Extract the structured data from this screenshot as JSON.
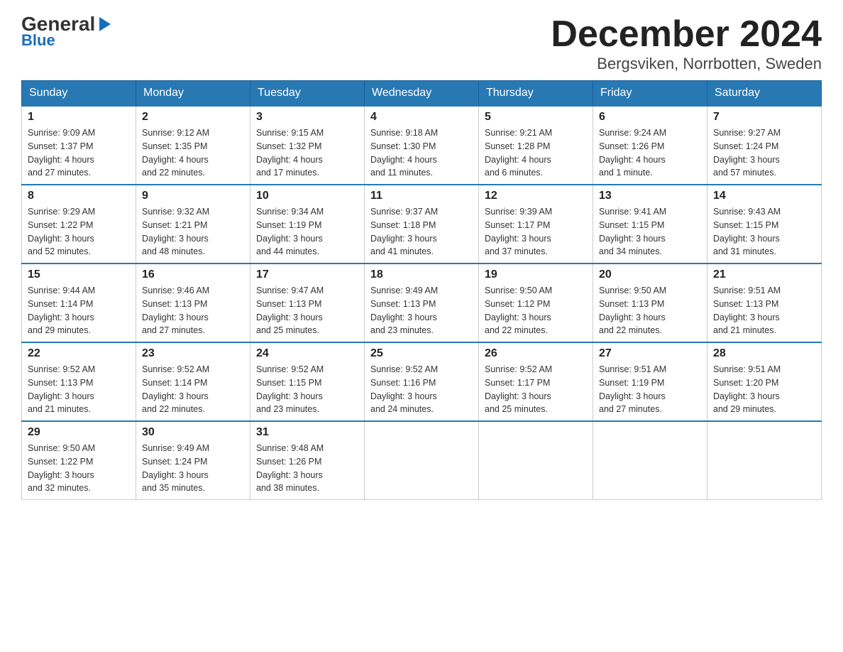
{
  "logo": {
    "text_general": "General",
    "text_blue": "Blue",
    "arrow_unicode": "▶"
  },
  "header": {
    "month_title": "December 2024",
    "location": "Bergsviken, Norrbotten, Sweden"
  },
  "weekdays": [
    "Sunday",
    "Monday",
    "Tuesday",
    "Wednesday",
    "Thursday",
    "Friday",
    "Saturday"
  ],
  "weeks": [
    [
      {
        "day": "1",
        "sunrise": "Sunrise: 9:09 AM",
        "sunset": "Sunset: 1:37 PM",
        "daylight": "Daylight: 4 hours",
        "daylight2": "and 27 minutes."
      },
      {
        "day": "2",
        "sunrise": "Sunrise: 9:12 AM",
        "sunset": "Sunset: 1:35 PM",
        "daylight": "Daylight: 4 hours",
        "daylight2": "and 22 minutes."
      },
      {
        "day": "3",
        "sunrise": "Sunrise: 9:15 AM",
        "sunset": "Sunset: 1:32 PM",
        "daylight": "Daylight: 4 hours",
        "daylight2": "and 17 minutes."
      },
      {
        "day": "4",
        "sunrise": "Sunrise: 9:18 AM",
        "sunset": "Sunset: 1:30 PM",
        "daylight": "Daylight: 4 hours",
        "daylight2": "and 11 minutes."
      },
      {
        "day": "5",
        "sunrise": "Sunrise: 9:21 AM",
        "sunset": "Sunset: 1:28 PM",
        "daylight": "Daylight: 4 hours",
        "daylight2": "and 6 minutes."
      },
      {
        "day": "6",
        "sunrise": "Sunrise: 9:24 AM",
        "sunset": "Sunset: 1:26 PM",
        "daylight": "Daylight: 4 hours",
        "daylight2": "and 1 minute."
      },
      {
        "day": "7",
        "sunrise": "Sunrise: 9:27 AM",
        "sunset": "Sunset: 1:24 PM",
        "daylight": "Daylight: 3 hours",
        "daylight2": "and 57 minutes."
      }
    ],
    [
      {
        "day": "8",
        "sunrise": "Sunrise: 9:29 AM",
        "sunset": "Sunset: 1:22 PM",
        "daylight": "Daylight: 3 hours",
        "daylight2": "and 52 minutes."
      },
      {
        "day": "9",
        "sunrise": "Sunrise: 9:32 AM",
        "sunset": "Sunset: 1:21 PM",
        "daylight": "Daylight: 3 hours",
        "daylight2": "and 48 minutes."
      },
      {
        "day": "10",
        "sunrise": "Sunrise: 9:34 AM",
        "sunset": "Sunset: 1:19 PM",
        "daylight": "Daylight: 3 hours",
        "daylight2": "and 44 minutes."
      },
      {
        "day": "11",
        "sunrise": "Sunrise: 9:37 AM",
        "sunset": "Sunset: 1:18 PM",
        "daylight": "Daylight: 3 hours",
        "daylight2": "and 41 minutes."
      },
      {
        "day": "12",
        "sunrise": "Sunrise: 9:39 AM",
        "sunset": "Sunset: 1:17 PM",
        "daylight": "Daylight: 3 hours",
        "daylight2": "and 37 minutes."
      },
      {
        "day": "13",
        "sunrise": "Sunrise: 9:41 AM",
        "sunset": "Sunset: 1:15 PM",
        "daylight": "Daylight: 3 hours",
        "daylight2": "and 34 minutes."
      },
      {
        "day": "14",
        "sunrise": "Sunrise: 9:43 AM",
        "sunset": "Sunset: 1:15 PM",
        "daylight": "Daylight: 3 hours",
        "daylight2": "and 31 minutes."
      }
    ],
    [
      {
        "day": "15",
        "sunrise": "Sunrise: 9:44 AM",
        "sunset": "Sunset: 1:14 PM",
        "daylight": "Daylight: 3 hours",
        "daylight2": "and 29 minutes."
      },
      {
        "day": "16",
        "sunrise": "Sunrise: 9:46 AM",
        "sunset": "Sunset: 1:13 PM",
        "daylight": "Daylight: 3 hours",
        "daylight2": "and 27 minutes."
      },
      {
        "day": "17",
        "sunrise": "Sunrise: 9:47 AM",
        "sunset": "Sunset: 1:13 PM",
        "daylight": "Daylight: 3 hours",
        "daylight2": "and 25 minutes."
      },
      {
        "day": "18",
        "sunrise": "Sunrise: 9:49 AM",
        "sunset": "Sunset: 1:13 PM",
        "daylight": "Daylight: 3 hours",
        "daylight2": "and 23 minutes."
      },
      {
        "day": "19",
        "sunrise": "Sunrise: 9:50 AM",
        "sunset": "Sunset: 1:12 PM",
        "daylight": "Daylight: 3 hours",
        "daylight2": "and 22 minutes."
      },
      {
        "day": "20",
        "sunrise": "Sunrise: 9:50 AM",
        "sunset": "Sunset: 1:13 PM",
        "daylight": "Daylight: 3 hours",
        "daylight2": "and 22 minutes."
      },
      {
        "day": "21",
        "sunrise": "Sunrise: 9:51 AM",
        "sunset": "Sunset: 1:13 PM",
        "daylight": "Daylight: 3 hours",
        "daylight2": "and 21 minutes."
      }
    ],
    [
      {
        "day": "22",
        "sunrise": "Sunrise: 9:52 AM",
        "sunset": "Sunset: 1:13 PM",
        "daylight": "Daylight: 3 hours",
        "daylight2": "and 21 minutes."
      },
      {
        "day": "23",
        "sunrise": "Sunrise: 9:52 AM",
        "sunset": "Sunset: 1:14 PM",
        "daylight": "Daylight: 3 hours",
        "daylight2": "and 22 minutes."
      },
      {
        "day": "24",
        "sunrise": "Sunrise: 9:52 AM",
        "sunset": "Sunset: 1:15 PM",
        "daylight": "Daylight: 3 hours",
        "daylight2": "and 23 minutes."
      },
      {
        "day": "25",
        "sunrise": "Sunrise: 9:52 AM",
        "sunset": "Sunset: 1:16 PM",
        "daylight": "Daylight: 3 hours",
        "daylight2": "and 24 minutes."
      },
      {
        "day": "26",
        "sunrise": "Sunrise: 9:52 AM",
        "sunset": "Sunset: 1:17 PM",
        "daylight": "Daylight: 3 hours",
        "daylight2": "and 25 minutes."
      },
      {
        "day": "27",
        "sunrise": "Sunrise: 9:51 AM",
        "sunset": "Sunset: 1:19 PM",
        "daylight": "Daylight: 3 hours",
        "daylight2": "and 27 minutes."
      },
      {
        "day": "28",
        "sunrise": "Sunrise: 9:51 AM",
        "sunset": "Sunset: 1:20 PM",
        "daylight": "Daylight: 3 hours",
        "daylight2": "and 29 minutes."
      }
    ],
    [
      {
        "day": "29",
        "sunrise": "Sunrise: 9:50 AM",
        "sunset": "Sunset: 1:22 PM",
        "daylight": "Daylight: 3 hours",
        "daylight2": "and 32 minutes."
      },
      {
        "day": "30",
        "sunrise": "Sunrise: 9:49 AM",
        "sunset": "Sunset: 1:24 PM",
        "daylight": "Daylight: 3 hours",
        "daylight2": "and 35 minutes."
      },
      {
        "day": "31",
        "sunrise": "Sunrise: 9:48 AM",
        "sunset": "Sunset: 1:26 PM",
        "daylight": "Daylight: 3 hours",
        "daylight2": "and 38 minutes."
      },
      null,
      null,
      null,
      null
    ]
  ]
}
